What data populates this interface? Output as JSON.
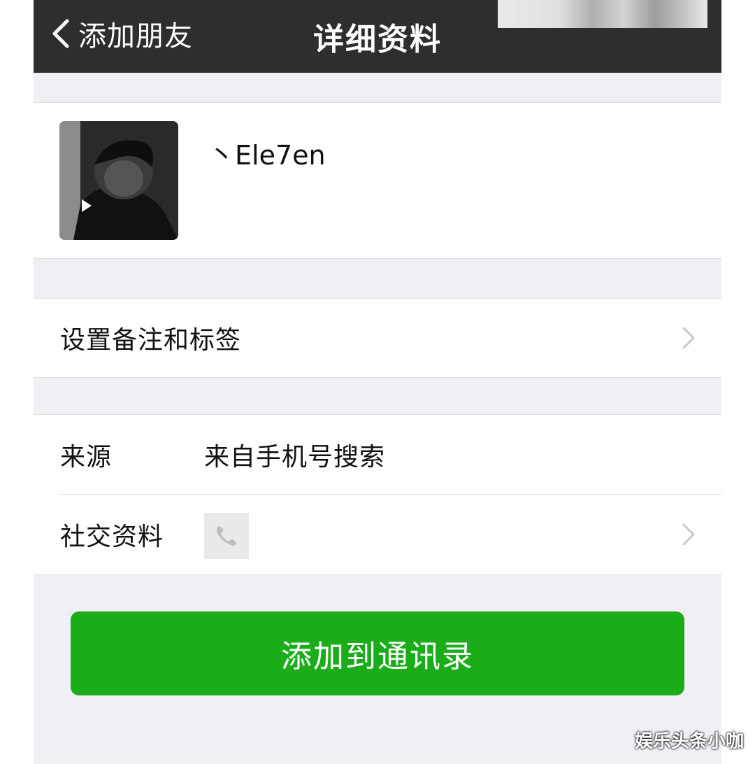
{
  "navbar": {
    "back_label": "添加朋友",
    "title": "详细资料"
  },
  "profile": {
    "nickname": "丶Ele7en"
  },
  "cells": {
    "remark_tags": "设置备注和标签",
    "source_label": "来源",
    "source_value": "来自手机号搜索",
    "social_label": "社交资料"
  },
  "actions": {
    "add_contact": "添加到通讯录"
  },
  "watermark": "娱乐头条小咖",
  "colors": {
    "navbar": "#2e2e30",
    "background": "#efeff4",
    "primary_green": "#1aad19"
  }
}
